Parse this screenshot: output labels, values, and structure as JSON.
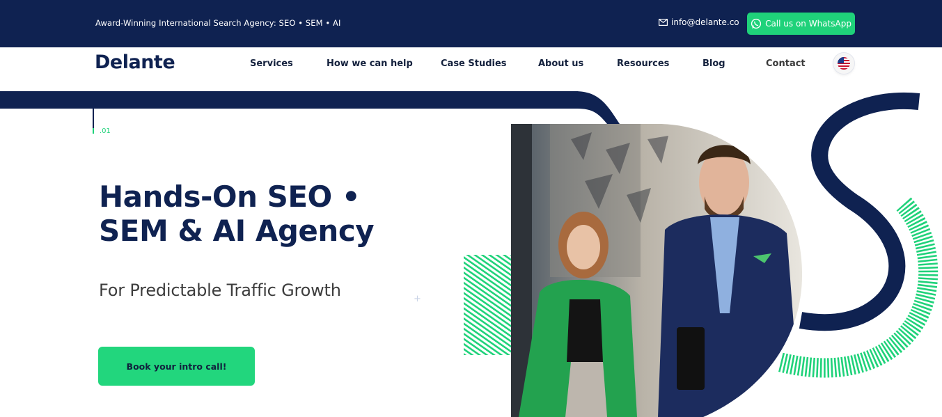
{
  "topbar": {
    "tagline": "Award-Winning International Search Agency: SEO • SEM • AI",
    "email": "info@delante.co",
    "whatsapp_label": "Call us on WhatsApp"
  },
  "nav": {
    "logo": "Delante",
    "items": [
      {
        "label": "Services"
      },
      {
        "label": "How we can help"
      },
      {
        "label": "Case Studies"
      },
      {
        "label": "About us"
      },
      {
        "label": "Resources"
      },
      {
        "label": "Blog"
      },
      {
        "label": "Contact"
      }
    ],
    "language_icon": "us-flag-icon"
  },
  "hero": {
    "slide_number": ".01",
    "headline_line1": "Hands-On SEO •",
    "headline_line2": "SEM & AI Agency",
    "subheadline": "For Predictable Traffic Growth",
    "cta_label": "Book your intro call!"
  },
  "colors": {
    "navy": "#0f2251",
    "green": "#1fd27a",
    "white": "#ffffff"
  },
  "icons": {
    "email": "envelope-icon",
    "whatsapp": "whatsapp-icon"
  }
}
